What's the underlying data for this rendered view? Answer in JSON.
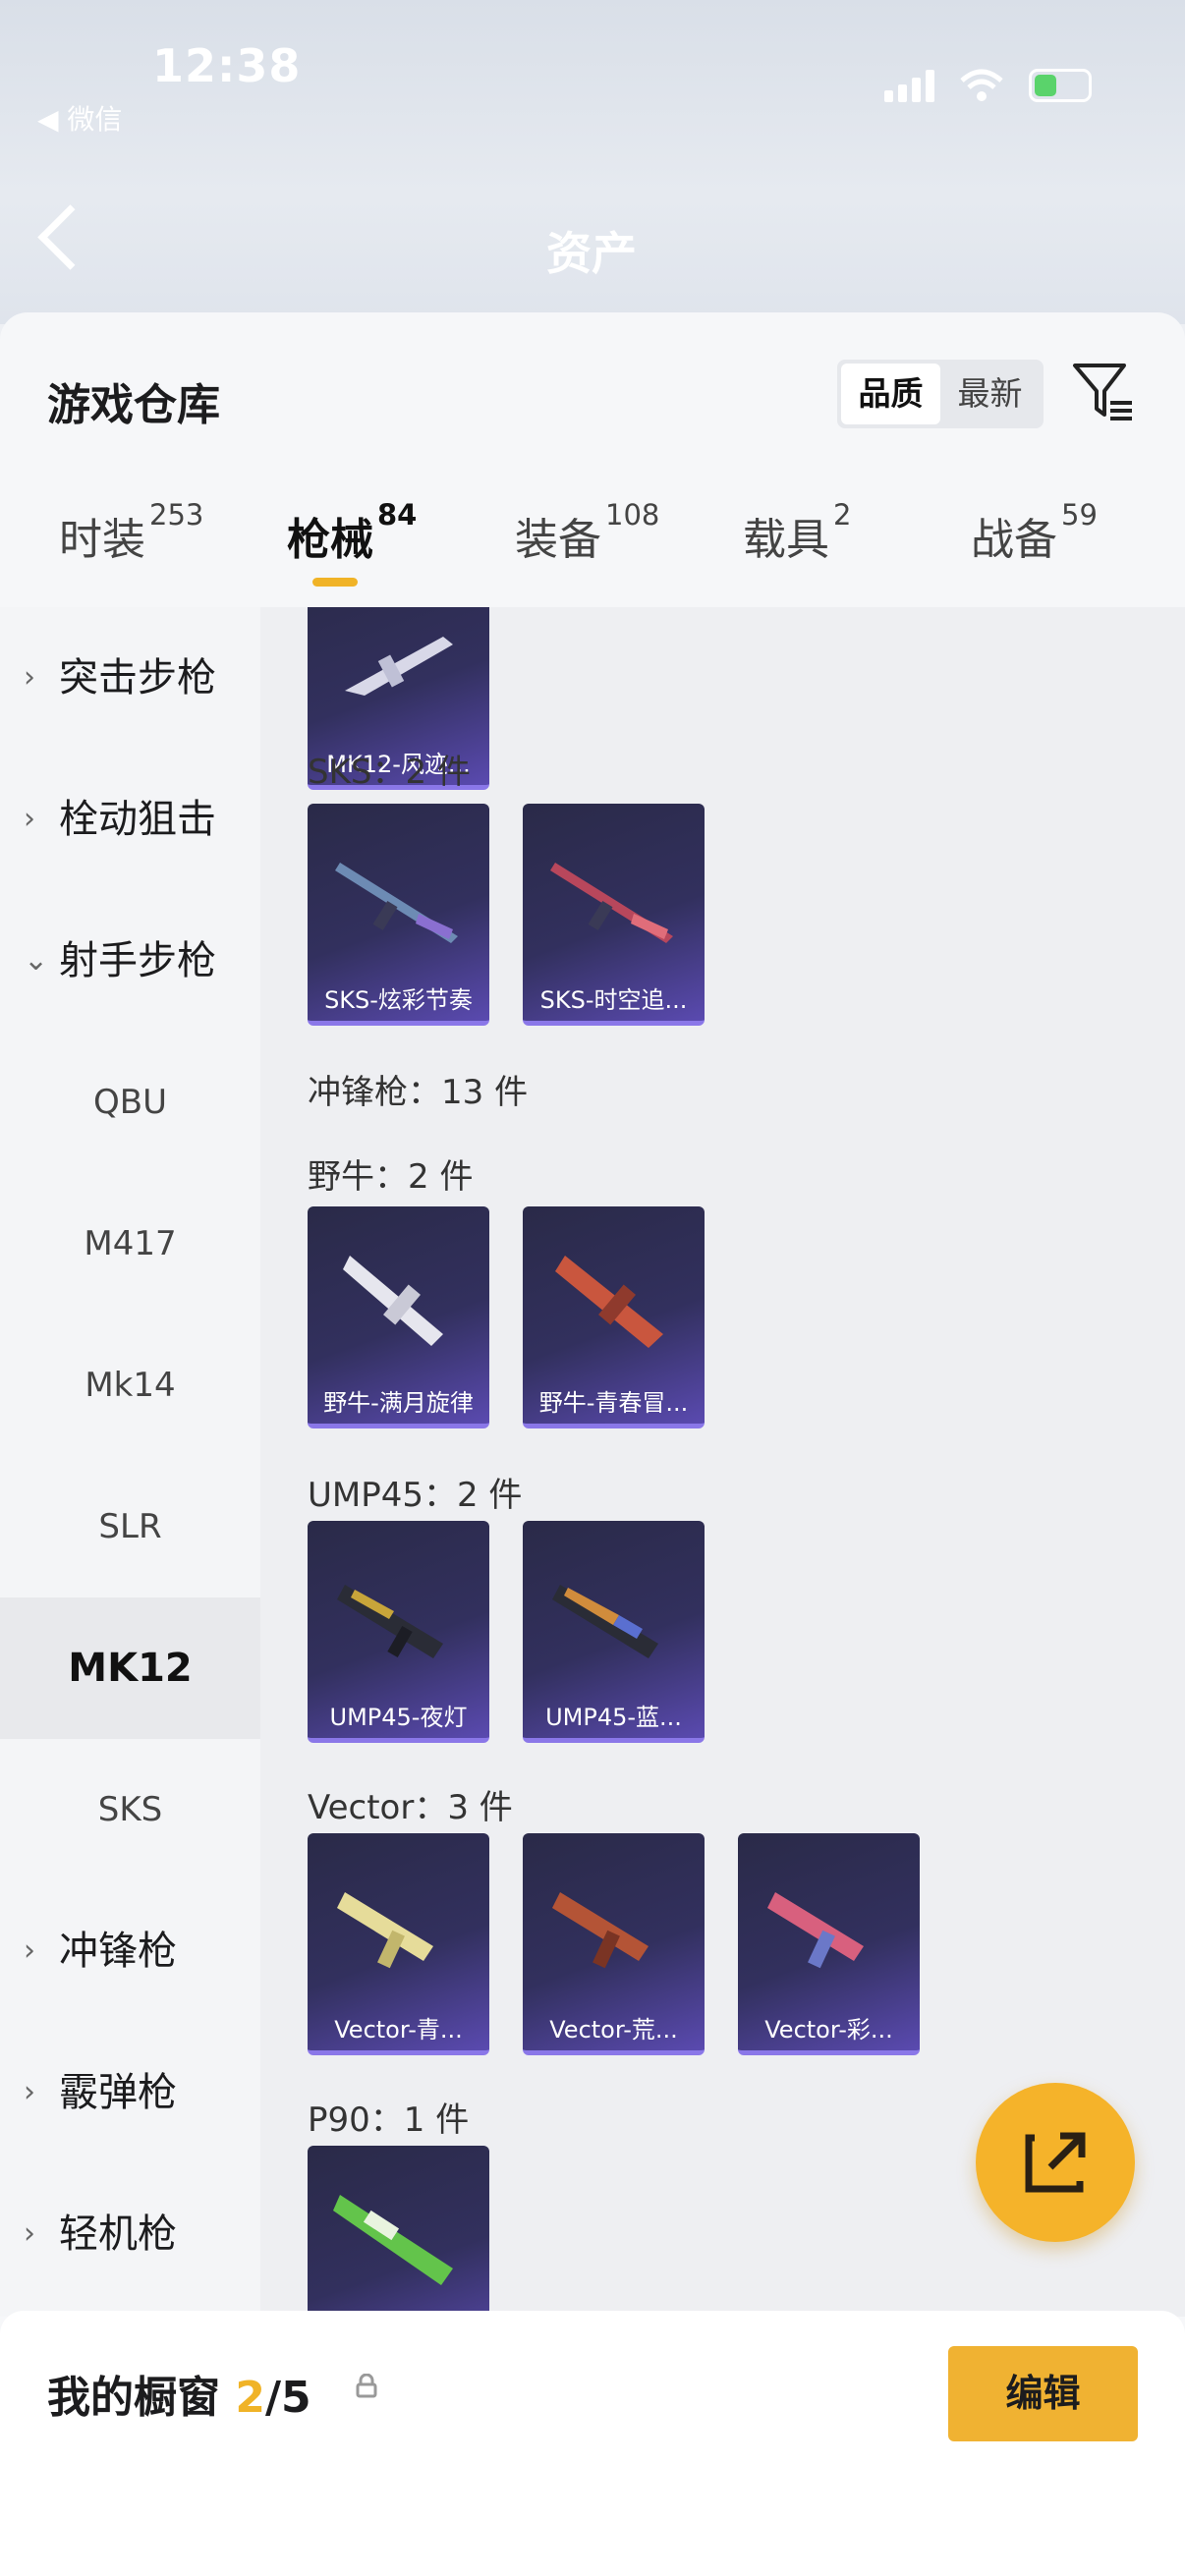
{
  "status_bar": {
    "time": "12:38",
    "back_app": "◀ 微信"
  },
  "background": {
    "title_ghost": "资产"
  },
  "sheet": {
    "title": "游戏仓库",
    "sort_options": [
      {
        "label": "品质",
        "selected": true
      },
      {
        "label": "最新",
        "selected": false
      }
    ],
    "tabs": [
      {
        "label": "时装",
        "count": "253"
      },
      {
        "label": "枪械",
        "count": "84",
        "active": true
      },
      {
        "label": "装备",
        "count": "108"
      },
      {
        "label": "载具",
        "count": "2"
      },
      {
        "label": "战备",
        "count": "59"
      }
    ]
  },
  "sidebar": {
    "categories": [
      {
        "label": "突击步枪",
        "chevron": "›"
      },
      {
        "label": "栓动狙击",
        "chevron": "›"
      },
      {
        "label": "射手步枪",
        "chevron": "⌄"
      }
    ],
    "subcategories": [
      "QBU",
      "M417",
      "Mk14",
      "SLR",
      "MK12",
      "SKS"
    ],
    "selected_sub": "MK12",
    "more_categories": [
      {
        "label": "冲锋枪",
        "chevron": "›"
      },
      {
        "label": "霰弹枪",
        "chevron": "›"
      },
      {
        "label": "轻机枪",
        "chevron": "›"
      }
    ]
  },
  "content": {
    "top_item": {
      "name": "MK12-风迹..."
    },
    "groups": [
      {
        "header": "SKS：2 件",
        "items": [
          "SKS-炫彩节奏",
          "SKS-时空追..."
        ]
      },
      {
        "header": "冲锋枪：13 件",
        "items": []
      },
      {
        "header": "野牛：2 件",
        "items": [
          "野牛-满月旋律",
          "野牛-青春冒..."
        ]
      },
      {
        "header": "UMP45：2 件",
        "items": [
          "UMP45-夜灯",
          "UMP45-蓝..."
        ]
      },
      {
        "header": "Vector：3 件",
        "items": [
          "Vector-青...",
          "Vector-荒...",
          "Vector-彩..."
        ]
      },
      {
        "header": "P90：1 件",
        "items": [
          ""
        ]
      }
    ]
  },
  "bottom_bar": {
    "label": "我的橱窗",
    "count_current": "2",
    "count_total": "/5",
    "edit_label": "编辑"
  },
  "colors": {
    "accent": "#f0b327",
    "item_bg": "#32305e",
    "item_border": "#8a77e8"
  },
  "icons": [
    "signal-icon",
    "wifi-icon",
    "battery-icon",
    "back-arrow-icon",
    "filter-icon",
    "chevron-right-icon",
    "chevron-down-icon",
    "share-icon",
    "lock-icon"
  ]
}
